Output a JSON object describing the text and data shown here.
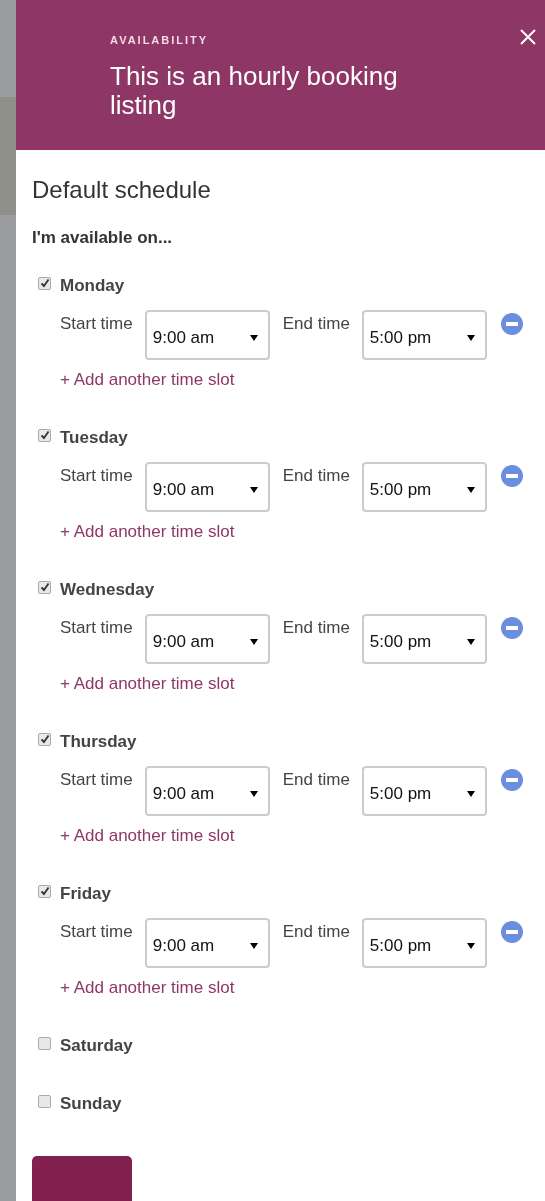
{
  "header": {
    "eyebrow": "AVAILABILITY",
    "title": "This is an hourly booking listing"
  },
  "section_title": "Default schedule",
  "prompt": "I'm available on...",
  "days": [
    {
      "name": "Monday",
      "checked": true,
      "slots": [
        {
          "start_label": "Start time",
          "start": "9:00 am",
          "end_label": "End time",
          "end": "5:00 pm"
        }
      ],
      "add_link": "+ Add another time slot"
    },
    {
      "name": "Tuesday",
      "checked": true,
      "slots": [
        {
          "start_label": "Start time",
          "start": "9:00 am",
          "end_label": "End time",
          "end": "5:00 pm"
        }
      ],
      "add_link": "+ Add another time slot"
    },
    {
      "name": "Wednesday",
      "checked": true,
      "slots": [
        {
          "start_label": "Start time",
          "start": "9:00 am",
          "end_label": "End time",
          "end": "5:00 pm"
        }
      ],
      "add_link": "+ Add another time slot"
    },
    {
      "name": "Thursday",
      "checked": true,
      "slots": [
        {
          "start_label": "Start time",
          "start": "9:00 am",
          "end_label": "End time",
          "end": "5:00 pm"
        }
      ],
      "add_link": "+ Add another time slot"
    },
    {
      "name": "Friday",
      "checked": true,
      "slots": [
        {
          "start_label": "Start time",
          "start": "9:00 am",
          "end_label": "End time",
          "end": "5:00 pm"
        }
      ],
      "add_link": "+ Add another time slot"
    },
    {
      "name": "Saturday",
      "checked": false
    },
    {
      "name": "Sunday",
      "checked": false
    }
  ]
}
